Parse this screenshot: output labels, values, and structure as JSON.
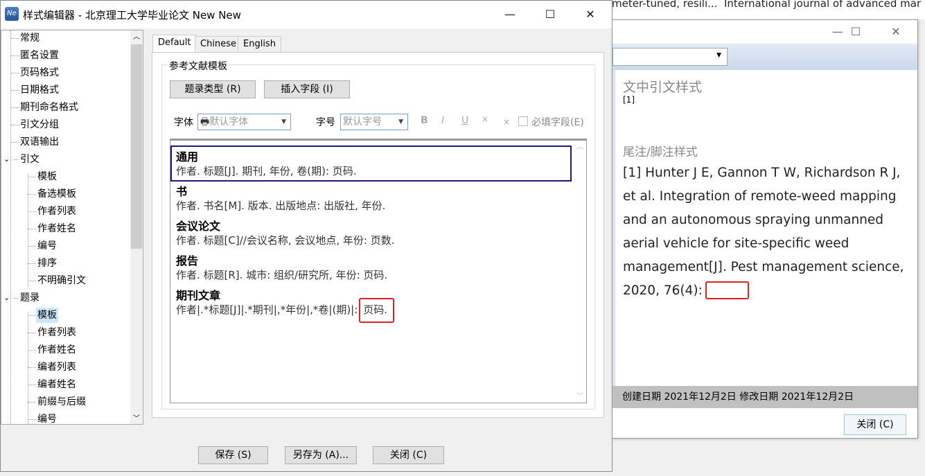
{
  "background_window": {
    "snippet1": "meter-tuned, resili...",
    "snippet2": "International journal of advanced mar"
  },
  "editor_window": {
    "title": "样式编辑器 - 北京理工大学毕业论文 New New",
    "app_icon_text": "Ne",
    "controls": {
      "minimize": "—",
      "maximize": "☐",
      "close": "✕"
    },
    "tree": [
      {
        "label": "常规",
        "level": 0
      },
      {
        "label": "匿名设置",
        "level": 0
      },
      {
        "label": "页码格式",
        "level": 0
      },
      {
        "label": "日期格式",
        "level": 0
      },
      {
        "label": "期刊命名格式",
        "level": 0
      },
      {
        "label": "引文分组",
        "level": 0
      },
      {
        "label": "双语输出",
        "level": 0
      },
      {
        "label": "引文",
        "level": 0,
        "expanded": true
      },
      {
        "label": "模板",
        "level": 1
      },
      {
        "label": "备选模板",
        "level": 1
      },
      {
        "label": "作者列表",
        "level": 1
      },
      {
        "label": "作者姓名",
        "level": 1
      },
      {
        "label": "编号",
        "level": 1
      },
      {
        "label": "排序",
        "level": 1
      },
      {
        "label": "不明确引文",
        "level": 1
      },
      {
        "label": "题录",
        "level": 0,
        "expanded": true
      },
      {
        "label": "模板",
        "level": 1,
        "selected": true
      },
      {
        "label": "作者列表",
        "level": 1
      },
      {
        "label": "作者姓名",
        "level": 1
      },
      {
        "label": "编者列表",
        "level": 1
      },
      {
        "label": "编者姓名",
        "level": 1
      },
      {
        "label": "前缀与后缀",
        "level": 1
      },
      {
        "label": "编号",
        "level": 1
      }
    ],
    "tabs": [
      "Default",
      "Chinese",
      "English"
    ],
    "active_tab": "Default",
    "group_label": "参考文献模板",
    "ref_type_button": "题录类型 (R)",
    "insert_field_button": "插入字段 (I)",
    "font_label": "字体",
    "font_value": "默认字体",
    "size_label": "字号",
    "size_value": "默认字号",
    "format_buttons": {
      "bold": "B",
      "italic": "I",
      "underline": "U",
      "sup": "×",
      "sub": "×"
    },
    "required_field_label": "必填字段(E)",
    "templates": [
      {
        "type": "通用",
        "text": "作者. 标题[J]. 期刊, 年份, 卷(期): 页码."
      },
      {
        "type": "书",
        "text": "作者. 书名[M]. 版本. 出版地点: 出版社, 年份."
      },
      {
        "type": "会议论文",
        "text": "作者. 标题[C]//会议名称, 会议地点, 年份: 页数."
      },
      {
        "type": "报告",
        "text": "作者. 标题[R]. 城市: 组织/研究所, 年份: 页码."
      },
      {
        "type": "期刊文章",
        "text": "作者|.*标题[J]|.*期刊|,*年份|,*卷|(期)|:",
        "text_highlight": "页码."
      }
    ],
    "save_button": "保存 (S)",
    "save_as_button": "另存为 (A)...",
    "close_button": "关闭 (C)"
  },
  "preview_window": {
    "controls": {
      "minimize": "—",
      "maximize": "☐",
      "close": "✕"
    },
    "intext_heading": "文中引文样式",
    "intext_sample": "[1]",
    "footnote_heading": "尾注/脚注样式",
    "footnote_sample": "[1] Hunter J E, Gannon T W, Richardson R J, et al. Integration of remote-weed mapping and an autonomous spraying unmanned aerial vehicle for site-specific weed management[J]. Pest management science, 2020, 76(4):",
    "status": "创建日期  2021年12月2日  修改日期  2021年12月2日",
    "close_button": "关闭 (C)"
  },
  "colors": {
    "highlight": "#e02020",
    "selection_border": "#1a1a7a",
    "tree_selected": "#cce8ff"
  }
}
